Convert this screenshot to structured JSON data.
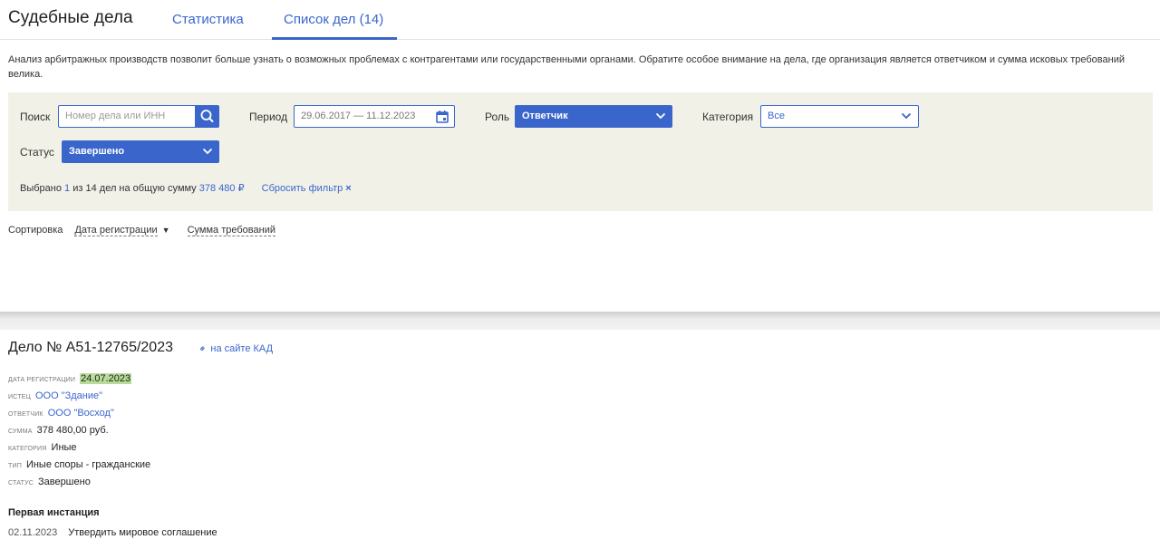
{
  "header": {
    "title": "Судебные дела",
    "tabs": [
      {
        "label": "Статистика"
      },
      {
        "label": "Список дел (14)"
      }
    ]
  },
  "intro": "Анализ арбитражных производств позволит больше узнать о возможных проблемах с контрагентами или государственными органами. Обратите особое внимание на дела, где организация является ответчиком и сумма исковых требований велика.",
  "filters": {
    "search": {
      "label": "Поиск",
      "placeholder": "Номер дела или ИНН",
      "icon": "search-icon"
    },
    "period": {
      "label": "Период",
      "value": "29.06.2017 — 11.12.2023",
      "icon": "calendar-icon"
    },
    "role": {
      "label": "Роль",
      "value": "Ответчик"
    },
    "category": {
      "label": "Категория",
      "value": "Все"
    },
    "status": {
      "label": "Статус",
      "value": "Завершено"
    },
    "summary": {
      "prefix": "Выбрано",
      "selected": "1",
      "middle": "из 14 дел на общую сумму",
      "amount": "378 480 ₽",
      "reset_label": "Сбросить фильтр",
      "reset_icon": "×"
    }
  },
  "sort": {
    "label": "Сортировка",
    "options": [
      {
        "label": "Дата регистрации",
        "arrow": "▼"
      },
      {
        "label": "Сумма требований"
      }
    ]
  },
  "case": {
    "title": "Дело № А51-12765/2023",
    "kad_link": "на сайте КАД",
    "kad_icon": "link-icon",
    "fields": [
      {
        "name": "ДАТА РЕГИСТРАЦИИ",
        "value": "24.07.2023"
      },
      {
        "name": "ИСТЕЦ",
        "value": "ООО \"Здание\""
      },
      {
        "name": "ОТВЕТЧИК",
        "value": "ООО \"Восход\""
      },
      {
        "name": "СУММА",
        "value": "378 480,00 руб."
      },
      {
        "name": "КАТЕГОРИЯ",
        "value": "Иные"
      },
      {
        "name": "ТИП",
        "value": "Иные споры - гражданские"
      },
      {
        "name": "СТАТУС",
        "value": "Завершено"
      }
    ],
    "instance": {
      "title": "Первая инстанция",
      "events": [
        {
          "date": "02.11.2023",
          "text": "Утвердить мировое соглашение"
        }
      ]
    }
  },
  "colors": {
    "accent": "#3a66cc",
    "filter_bg": "#f1f1e8",
    "date_highlight": "#b7dc9a"
  }
}
